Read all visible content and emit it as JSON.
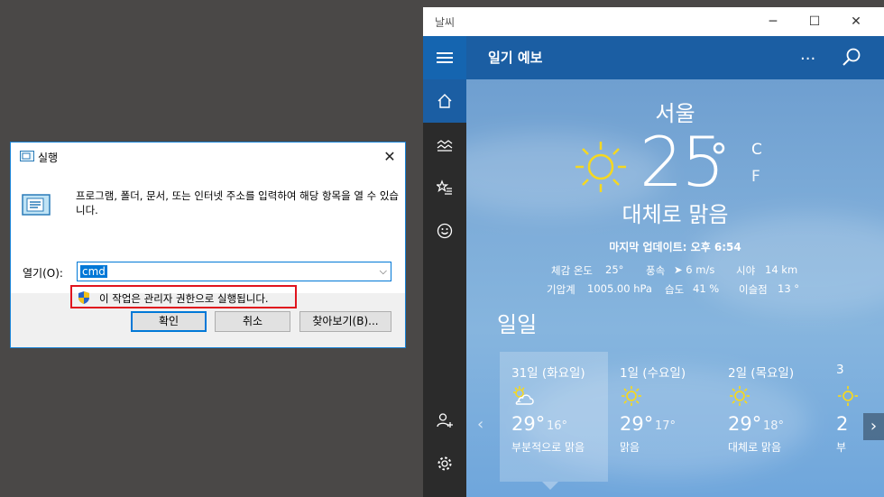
{
  "run_dialog": {
    "title": "실행",
    "description": "프로그램, 폴더, 문서, 또는 인터넷 주소를 입력하여 해당 항목을 열 수 있습니다.",
    "open_label": "열기(O):",
    "input_value": "cmd",
    "admin_notice": "이 작업은 관리자 권한으로 실행됩니다.",
    "buttons": {
      "ok": "확인",
      "cancel": "취소",
      "browse": "찾아보기(B)..."
    },
    "highlight_color": "#e0141e"
  },
  "weather": {
    "window_title": "날씨",
    "header_title": "일기 예보",
    "more": "...",
    "city": "서울",
    "temperature": "25",
    "degree": "°",
    "unit_c": "C",
    "unit_f": "F",
    "condition": "대체로 맑음",
    "updated": "마지막 업데이트: 오후 6:54",
    "details": {
      "feels_label": "체감 온도",
      "feels_value": "25°",
      "wind_label": "풍속",
      "wind_value": "➤ 6 m/s",
      "visibility_label": "시야",
      "visibility_value": "14 km",
      "pressure_label": "기압계",
      "pressure_value": "1005.00 hPa",
      "humidity_label": "습도",
      "humidity_value": "41 %",
      "dew_label": "이슬점",
      "dew_value": "13 °"
    },
    "daily_title": "일일",
    "days": [
      {
        "name": "31일 (화요일)",
        "hi": "29°",
        "lo": "16°",
        "cond": "부분적으로 맑음",
        "icon": "partly-cloudy-icon"
      },
      {
        "name": "1일 (수요일)",
        "hi": "29°",
        "lo": "17°",
        "cond": "맑음",
        "icon": "sun-icon"
      },
      {
        "name": "2일 (목요일)",
        "hi": "29°",
        "lo": "18°",
        "cond": "대체로 맑음",
        "icon": "sun-icon"
      },
      {
        "name": "3",
        "hi": "2",
        "lo": "",
        "cond": "부",
        "icon": "sun-icon"
      }
    ],
    "accent_color": "#1b5ea3",
    "sun_color": "#f5d820"
  }
}
